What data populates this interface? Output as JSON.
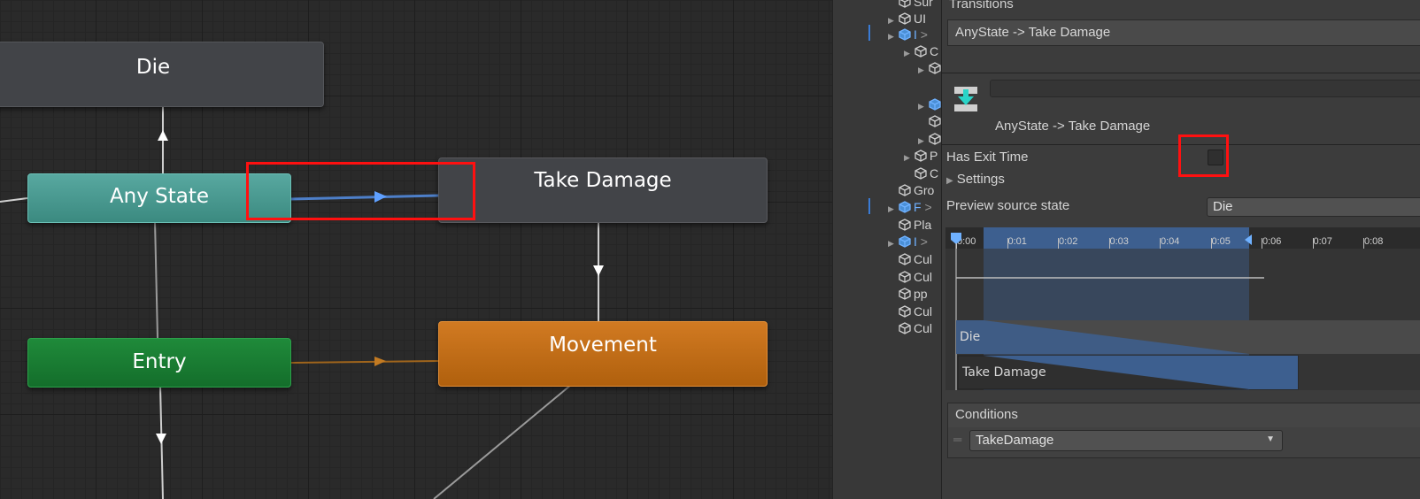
{
  "graph": {
    "nodes": {
      "die": "Die",
      "any_state": "Any State",
      "take_damage": "Take Damage",
      "entry": "Entry",
      "movement": "Movement"
    }
  },
  "hierarchy": {
    "items": [
      {
        "label": "Sur",
        "type": "cube"
      },
      {
        "label": "UI",
        "type": "cube"
      },
      {
        "label": "I",
        "type": "prefab",
        "suffix": ">"
      },
      {
        "label": "C",
        "type": "cube"
      },
      {
        "label": "",
        "type": "cube"
      },
      {
        "label": "",
        "type": "prefab"
      },
      {
        "label": "",
        "type": "cube"
      },
      {
        "label": "",
        "type": "cube"
      },
      {
        "label": "P",
        "type": "cube"
      },
      {
        "label": "C",
        "type": "cube"
      },
      {
        "label": "Gro",
        "type": "cube"
      },
      {
        "label": "F",
        "type": "prefab",
        "suffix": ">"
      },
      {
        "label": "Pla",
        "type": "cube"
      },
      {
        "label": "I",
        "type": "prefab",
        "suffix": ">"
      },
      {
        "label": "Cul",
        "type": "cube"
      },
      {
        "label": "Cul",
        "type": "cube"
      },
      {
        "label": "pp",
        "type": "cube"
      },
      {
        "label": "Cul",
        "type": "cube"
      },
      {
        "label": "Cul",
        "type": "cube"
      }
    ]
  },
  "inspector": {
    "transitions_header": "Transitions",
    "transition_item": "AnyState -> Take Damage",
    "transition_title": "AnyState -> Take Damage",
    "has_exit_time_label": "Has Exit Time",
    "has_exit_time": false,
    "settings_label": "Settings",
    "preview_source_label": "Preview source state",
    "preview_source_value": "Die",
    "timeline": {
      "ticks": [
        "0:00",
        "0:01",
        "0:02",
        "0:03",
        "0:04",
        "0:05",
        "0:06",
        "0:07",
        "0:08"
      ],
      "source_clip": "Die",
      "dest_clip": "Take Damage"
    },
    "conditions_label": "Conditions",
    "condition_parameter": "TakeDamage"
  },
  "colors": {
    "any_state": "#4a9b90",
    "entry": "#1a7d34",
    "movement": "#c06d18",
    "highlight": "#ff1010",
    "timeline_blue": "#3d5f8f"
  }
}
